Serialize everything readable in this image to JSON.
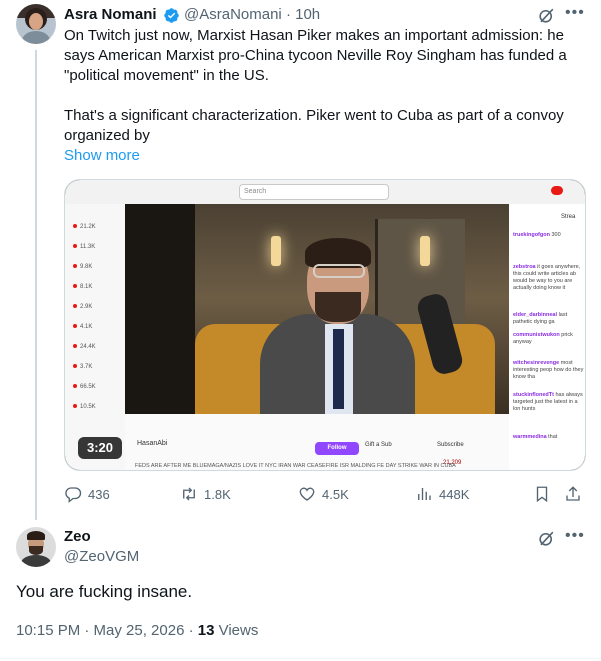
{
  "tweet": {
    "author_name": "Asra Nomani",
    "author_handle": "@AsraNomani",
    "separator": "·",
    "time_ago": "10h",
    "paragraph1": "On Twitch just now, Marxist Hasan Piker makes an important admission: he says American Marxist pro-China tycoon Neville Roy Singham has funded a \"political movement\" in the US.",
    "paragraph2": "That's a significant characterization. Piker went to Cuba as part of a convoy organized by",
    "show_more": "Show more",
    "video": {
      "duration": "3:20",
      "search_placeholder": "Search",
      "left_counts": [
        "21.2K",
        "11.3K",
        "9.8K",
        "8.1K",
        "2.9K",
        "4.1K",
        "24.4K",
        "3.7K",
        "66.5K",
        "10.5K"
      ],
      "streamer": "HasanAbi",
      "follow": "Follow",
      "gift": "Gift a Sub",
      "subscribe": "Subscribe",
      "viewers": "21,209",
      "ticker": "FEDS ARE AFTER ME BLUEMAGA/NAZIS LOVE IT NYC IRAN WAR CEASEFIRE ISR MALDING FE DAY STRIKE WAR IN CUBA",
      "chat_header": "Strea",
      "chat": [
        {
          "user": "truekingofgon",
          "text": "300"
        },
        {
          "user": "zebstroa",
          "text": "it goes anywhere, this could write articles ab would be way to you are actually doing know it"
        },
        {
          "user": "elder_darbinneal",
          "text": "last pathetic dying ga"
        },
        {
          "user": "communistwukon",
          "text": "prick anyway"
        },
        {
          "user": "witchesinrevenge",
          "text": "most interesting peop how do they know tha"
        },
        {
          "user": "stuckinflonedTt",
          "text": "has always targeted just the latest in a lon hunts"
        },
        {
          "user": "warmmedina",
          "text": "that"
        }
      ]
    },
    "actions": {
      "replies": "436",
      "retweets": "1.8K",
      "likes": "4.5K",
      "views": "448K"
    }
  },
  "reply": {
    "author_name": "Zeo",
    "author_handle": "@ZeoVGM",
    "text": "You are fucking insane.",
    "time": "10:15 PM · May 25, 2026 · ",
    "views_count": "13",
    "views_label": " Views"
  },
  "colors": {
    "accent": "#1d9bf0",
    "muted": "#536471",
    "text": "#0f1419",
    "twitch_purple": "#9147ff"
  }
}
